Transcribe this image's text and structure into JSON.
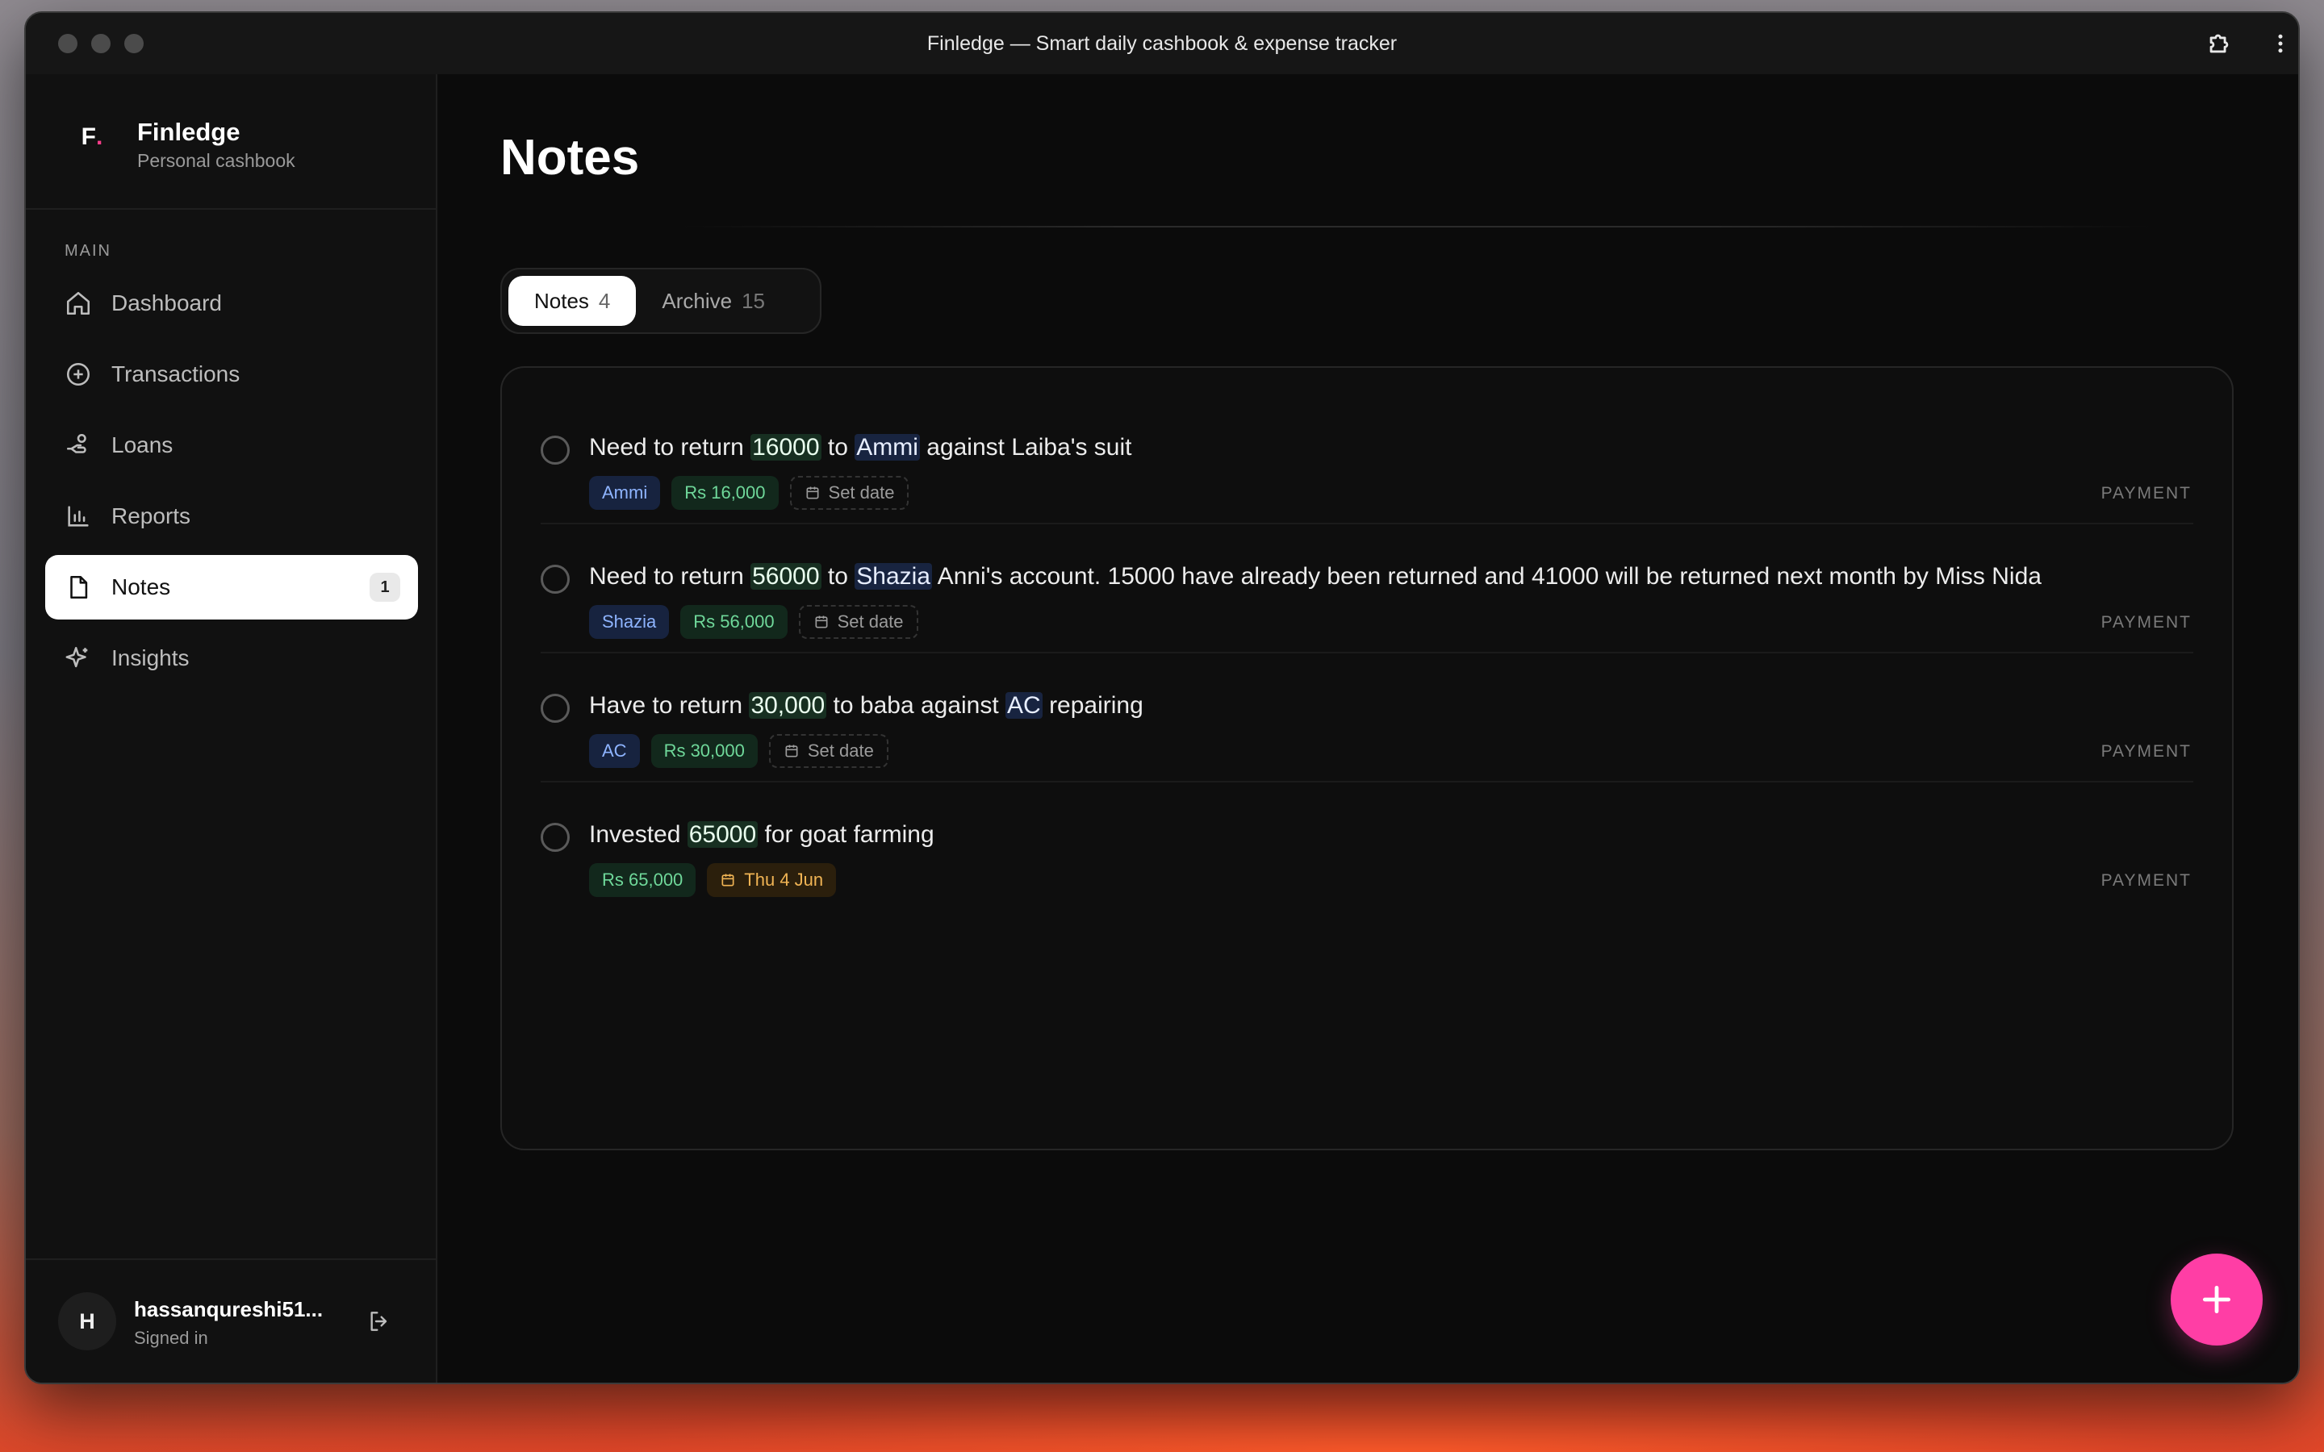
{
  "window": {
    "title": "Finledge — Smart daily cashbook & expense tracker"
  },
  "brand": {
    "logo_letter": "F",
    "logo_dot": ".",
    "name": "Finledge",
    "subtitle": "Personal cashbook"
  },
  "sidebar": {
    "section_label": "MAIN",
    "items": [
      {
        "label": "Dashboard",
        "icon": "home-icon"
      },
      {
        "label": "Transactions",
        "icon": "plus-circle-icon"
      },
      {
        "label": "Loans",
        "icon": "hand-coins-icon"
      },
      {
        "label": "Reports",
        "icon": "bar-chart-icon"
      },
      {
        "label": "Notes",
        "icon": "file-icon",
        "badge": "1",
        "active": true
      },
      {
        "label": "Insights",
        "icon": "sparkles-icon"
      }
    ]
  },
  "user": {
    "initial": "H",
    "name": "hassanqureshi51...",
    "status": "Signed in"
  },
  "main": {
    "title": "Notes",
    "tabs": [
      {
        "label": "Notes",
        "count": "4",
        "active": true
      },
      {
        "label": "Archive",
        "count": "15"
      }
    ]
  },
  "notes": [
    {
      "parts": [
        "Need to return ",
        "16000",
        " to ",
        "Ammi",
        " against Laiba's suit"
      ],
      "name_chip": "Ammi",
      "amount_chip": "Rs 16,000",
      "date_chip": "Set date",
      "type": "PAYMENT"
    },
    {
      "parts": [
        "Need to return ",
        "56000",
        " to ",
        "Shazia",
        " Anni's account. 15000 have already been returned and 41000 will be returned next month by Miss Nida"
      ],
      "name_chip": "Shazia",
      "amount_chip": "Rs 56,000",
      "date_chip": "Set date",
      "type": "PAYMENT"
    },
    {
      "parts": [
        "Have to return ",
        "30,000",
        " to baba against ",
        "AC",
        " repairing"
      ],
      "name_chip": "AC",
      "amount_chip": "Rs 30,000",
      "date_chip": "Set date",
      "type": "PAYMENT"
    },
    {
      "parts": [
        "Invested ",
        "65000",
        " for goat farming"
      ],
      "amount_chip": "Rs 65,000",
      "date_chip": "Thu 4 Jun",
      "type": "PAYMENT"
    }
  ],
  "colors": {
    "accent": "#ff3ea5",
    "name_chip": "#8eb4ff",
    "amount_chip": "#6fd89a",
    "date_set_chip": "#f0b454",
    "background": "#0b0b0b"
  }
}
